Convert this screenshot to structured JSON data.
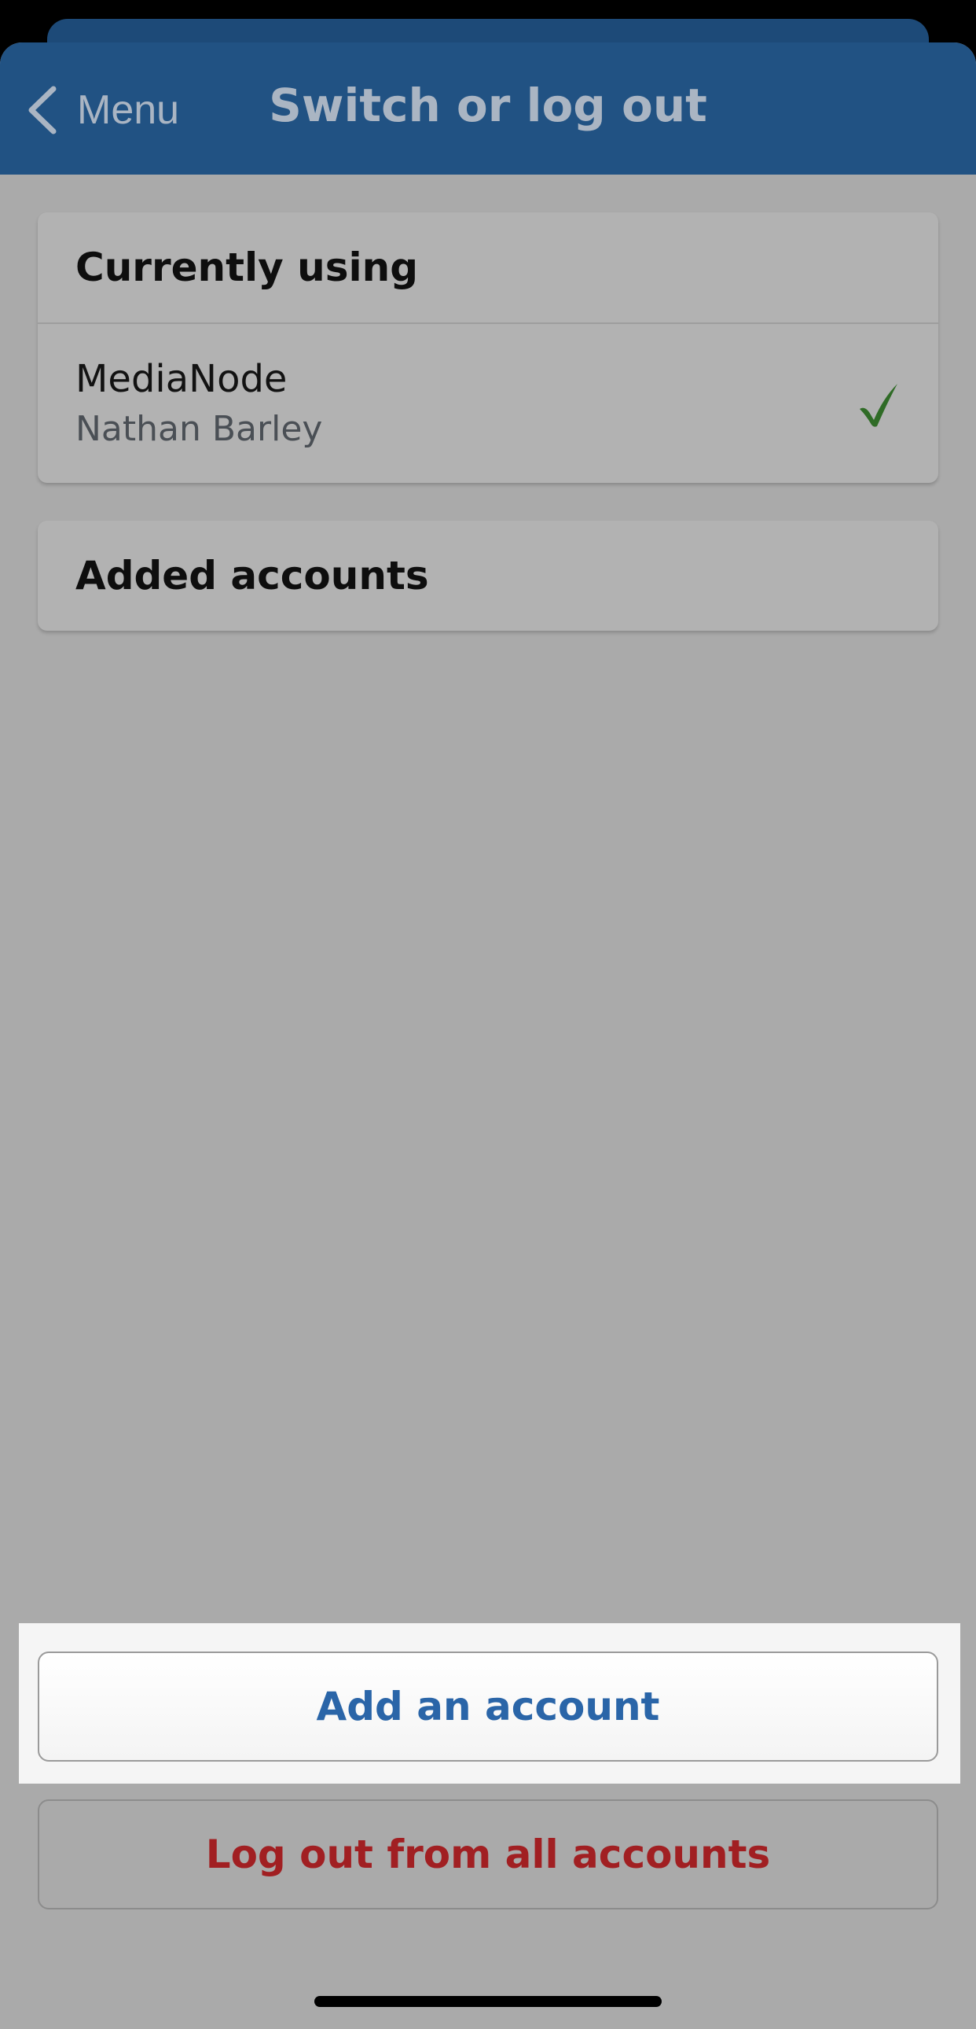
{
  "navbar": {
    "back_label": "Menu",
    "title": "Switch or log out"
  },
  "current_section": {
    "header": "Currently using",
    "account": {
      "name": "MediaNode",
      "user": "Nathan Barley",
      "selected_icon": "checkmark-icon"
    }
  },
  "added_section": {
    "header": "Added accounts"
  },
  "actions": {
    "add_account": "Add an account",
    "logout_all": "Log out from all accounts"
  },
  "colors": {
    "navbar": "#215283",
    "accent_blue": "#2a65a8",
    "danger_red": "#a11f22",
    "check_green": "#2f6b26"
  }
}
